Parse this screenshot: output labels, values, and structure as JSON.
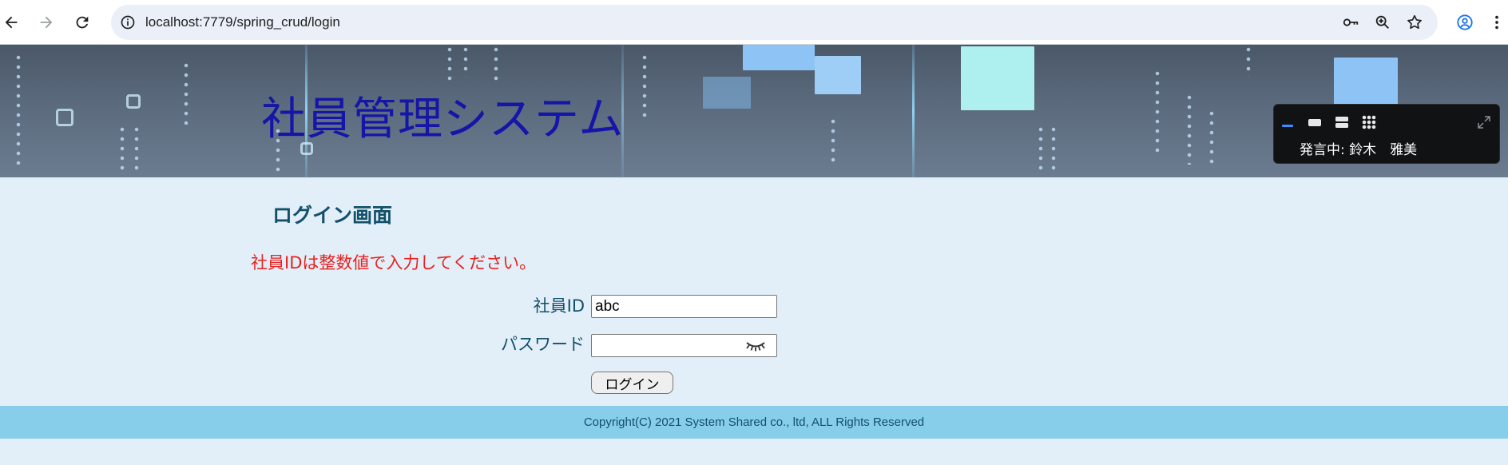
{
  "browser": {
    "url": "localhost:7779/spring_crud/login",
    "icons": {
      "back": "back-arrow-icon",
      "forward": "forward-arrow-icon",
      "reload": "reload-icon",
      "site_info": "site-info-icon",
      "password_key": "key-icon",
      "zoom": "zoom-icon",
      "bookmark": "star-icon",
      "profile": "profile-icon",
      "menu": "kebab-menu-icon"
    }
  },
  "header": {
    "title": "社員管理システム"
  },
  "meeting_widget": {
    "speaking_label": "発言中: 鈴木　雅美",
    "accent_color": "#3b8cff"
  },
  "main": {
    "heading": "ログイン画面",
    "error_message": "社員IDは整数値で入力してください。",
    "employee_id": {
      "label": "社員ID",
      "value": "abc"
    },
    "password": {
      "label": "パスワード",
      "value": ""
    },
    "login_button_label": "ログイン"
  },
  "footer": {
    "copyright": "Copyright(C) 2021 System Shared co., ltd, ALL Rights Reserved"
  },
  "colors": {
    "page_bg": "#e2eef8",
    "title": "#1515a8",
    "heading": "#13506a",
    "error": "#e8211f",
    "footer_bg": "#87ceeb"
  }
}
